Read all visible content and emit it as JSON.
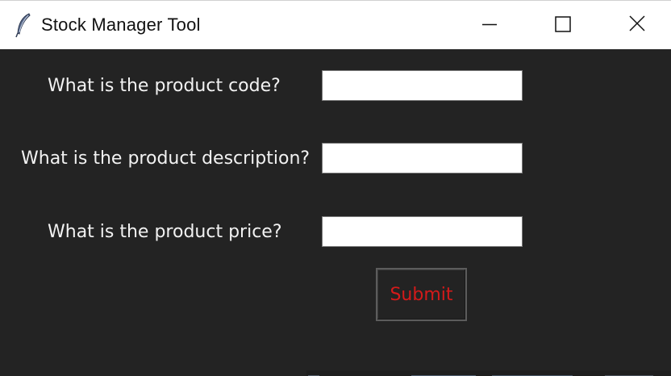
{
  "window": {
    "title": "Stock Manager Tool",
    "icon": "feather-icon",
    "controls": {
      "minimize": "minimize-icon",
      "maximize": "maximize-icon",
      "close": "close-icon"
    }
  },
  "form": {
    "code_label": "What is the product code?",
    "code_value": "",
    "description_label": "What is the product description?",
    "description_value": "",
    "price_label": "What is the product price?",
    "price_value": "",
    "submit_label": "Submit"
  },
  "colors": {
    "background": "#232323",
    "label_text": "#f2f2f2",
    "submit_text": "#d41a1a",
    "titlebar": "#ffffff"
  }
}
